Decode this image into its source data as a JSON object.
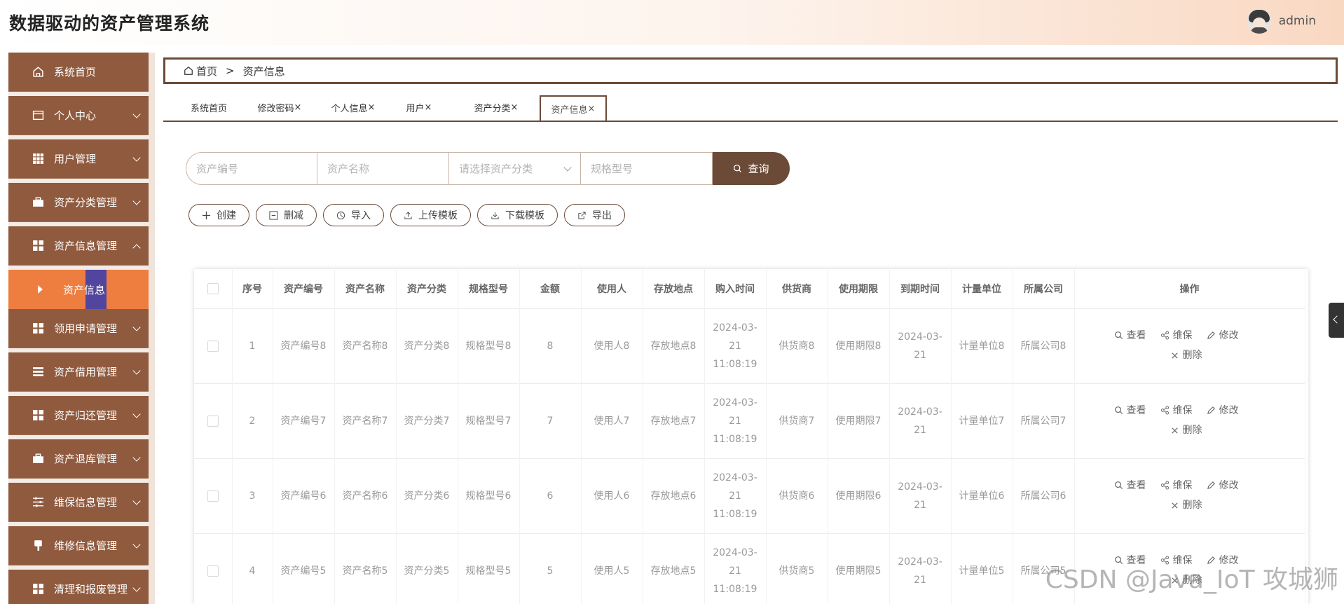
{
  "app": {
    "title": "数据驱动的资产管理系统",
    "user": "admin"
  },
  "sidebar": {
    "items": [
      {
        "label": "系统首页",
        "icon": "home-icon",
        "expand": "none"
      },
      {
        "label": "个人中心",
        "icon": "id-card-icon",
        "expand": "down"
      },
      {
        "label": "用户管理",
        "icon": "grid-icon",
        "expand": "down"
      },
      {
        "label": "资产分类管理",
        "icon": "briefcase-icon",
        "expand": "down"
      },
      {
        "label": "资产信息管理",
        "icon": "tiles-icon",
        "expand": "up"
      },
      {
        "label": "领用申请管理",
        "icon": "tiles-icon",
        "expand": "down"
      },
      {
        "label": "资产借用管理",
        "icon": "list-icon",
        "expand": "down"
      },
      {
        "label": "资产归还管理",
        "icon": "tiles-icon",
        "expand": "down"
      },
      {
        "label": "资产退库管理",
        "icon": "briefcase-icon",
        "expand": "down"
      },
      {
        "label": "维保信息管理",
        "icon": "sliders-icon",
        "expand": "down"
      },
      {
        "label": "维修信息管理",
        "icon": "brush-icon",
        "expand": "down"
      },
      {
        "label": "清理和报废管理",
        "icon": "tiles-icon",
        "expand": "down"
      }
    ],
    "active_sub": "资产信息"
  },
  "breadcrumb": {
    "home": "首页",
    "separator": ">",
    "current": "资产信息"
  },
  "tabs": [
    {
      "label": "系统首页",
      "closable": false
    },
    {
      "label": "修改密码",
      "closable": true
    },
    {
      "label": "个人信息",
      "closable": true
    },
    {
      "label": "用户",
      "closable": true
    },
    {
      "label": "资产分类",
      "closable": true
    },
    {
      "label": "资产信息",
      "closable": true,
      "active": true
    }
  ],
  "tab_close": "×",
  "search": {
    "code_placeholder": "资产编号",
    "name_placeholder": "资产名称",
    "category_placeholder": "请选择资产分类",
    "model_placeholder": "规格型号",
    "button": "查询"
  },
  "actions": {
    "create": "创建",
    "delete": "删减",
    "import": "导入",
    "upload_template": "上传模板",
    "download_template": "下载模板",
    "export": "导出"
  },
  "table": {
    "headers": [
      "序号",
      "资产编号",
      "资产名称",
      "资产分类",
      "规格型号",
      "金额",
      "使用人",
      "存放地点",
      "购入时间",
      "供货商",
      "使用期限",
      "到期时间",
      "计量单位",
      "所属公司",
      "操作"
    ],
    "rows": [
      {
        "idx": "1",
        "code": "资产编号8",
        "name": "资产名称8",
        "category": "资产分类8",
        "model": "规格型号8",
        "amount": "8",
        "user": "使用人8",
        "location": "存放地点8",
        "purchase": "2024-03-21 11:08:19",
        "supplier": "供货商8",
        "term": "使用期限8",
        "expire": "2024-03-21",
        "unit": "计量单位8",
        "company": "所属公司8"
      },
      {
        "idx": "2",
        "code": "资产编号7",
        "name": "资产名称7",
        "category": "资产分类7",
        "model": "规格型号7",
        "amount": "7",
        "user": "使用人7",
        "location": "存放地点7",
        "purchase": "2024-03-21 11:08:19",
        "supplier": "供货商7",
        "term": "使用期限7",
        "expire": "2024-03-21",
        "unit": "计量单位7",
        "company": "所属公司7"
      },
      {
        "idx": "3",
        "code": "资产编号6",
        "name": "资产名称6",
        "category": "资产分类6",
        "model": "规格型号6",
        "amount": "6",
        "user": "使用人6",
        "location": "存放地点6",
        "purchase": "2024-03-21 11:08:19",
        "supplier": "供货商6",
        "term": "使用期限6",
        "expire": "2024-03-21",
        "unit": "计量单位6",
        "company": "所属公司6"
      },
      {
        "idx": "4",
        "code": "资产编号5",
        "name": "资产名称5",
        "category": "资产分类5",
        "model": "规格型号5",
        "amount": "5",
        "user": "使用人5",
        "location": "存放地点5",
        "purchase": "2024-03-21 11:08:19",
        "supplier": "供货商5",
        "term": "使用期限5",
        "expire": "2024-03-21",
        "unit": "计量单位5",
        "company": "所属公司5"
      }
    ],
    "ops": {
      "view": "查看",
      "maintain": "维保",
      "edit": "修改",
      "remove": "删除"
    }
  },
  "watermark": "CSDN @Java_IoT 攻城狮",
  "colors": {
    "brand": "#8f5a3e",
    "active": "#ee7d40",
    "dark": "#6b4a38"
  }
}
